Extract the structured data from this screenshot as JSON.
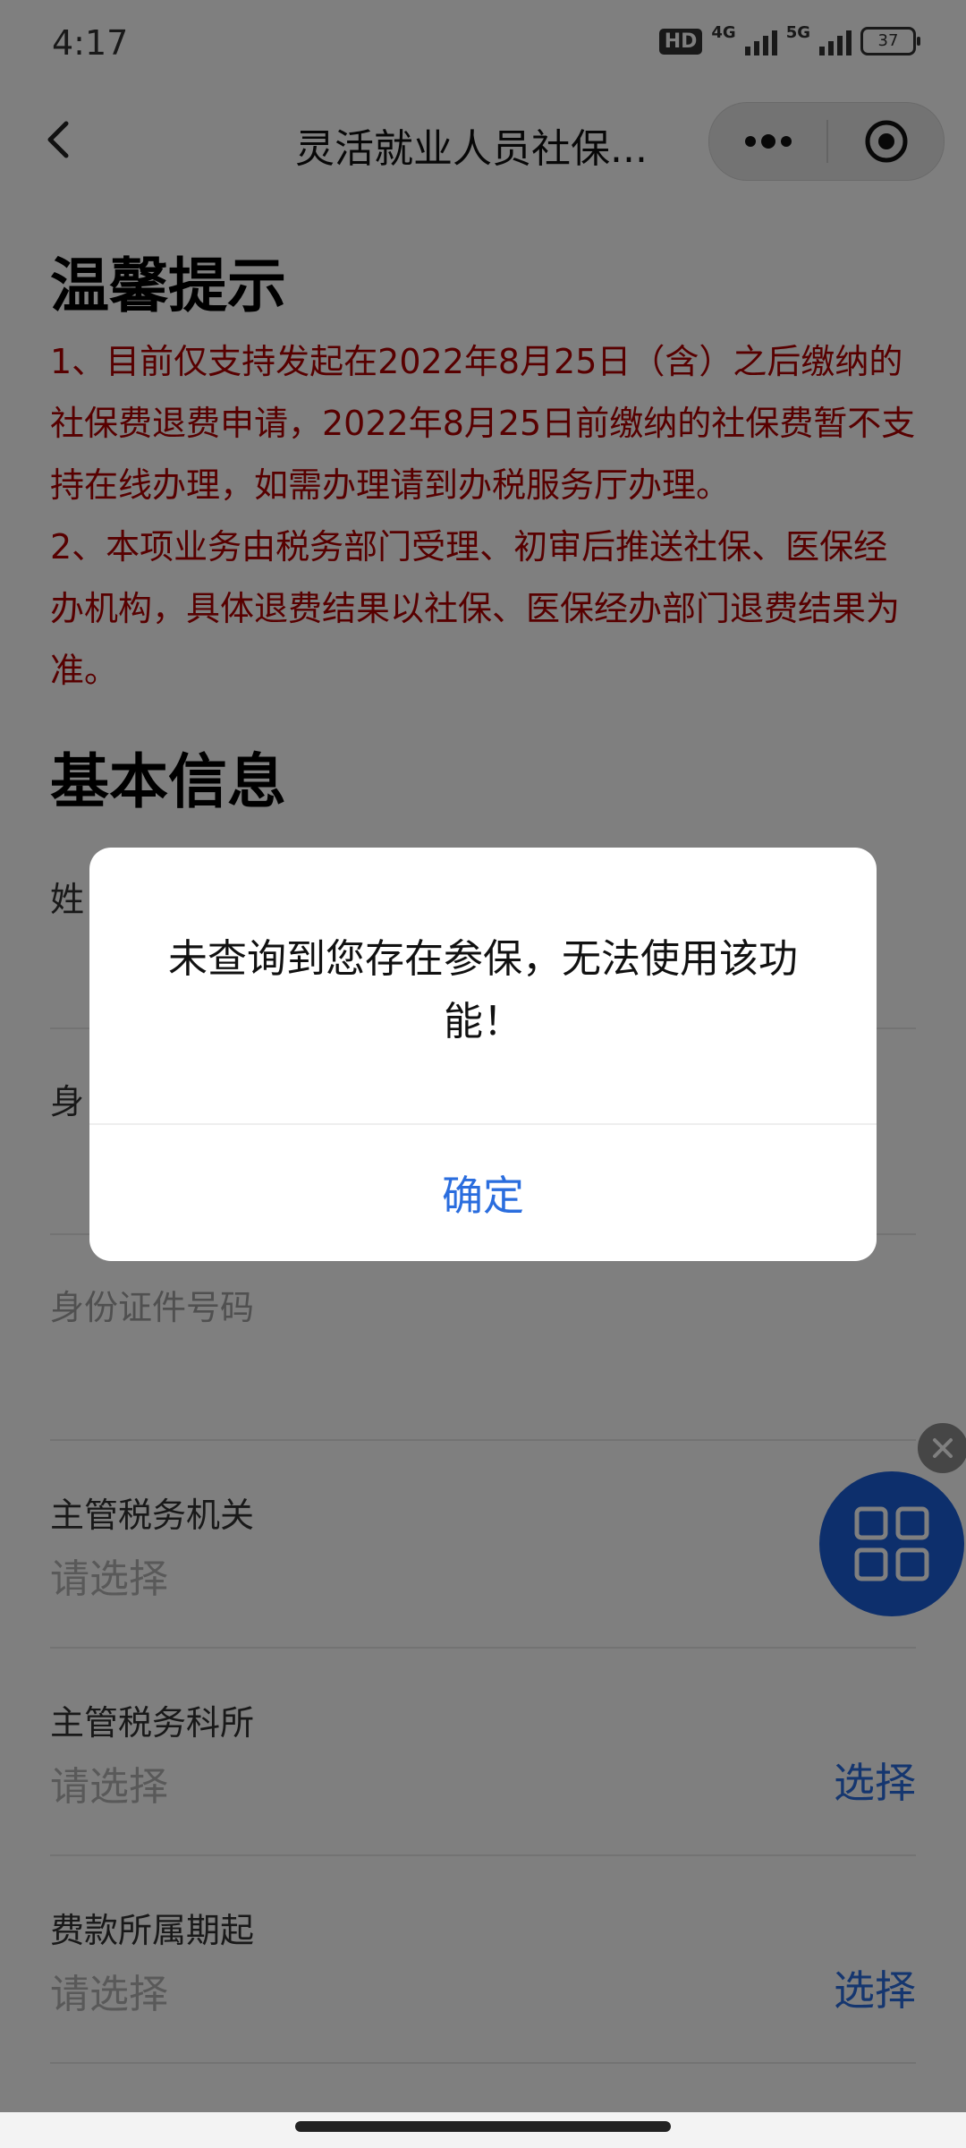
{
  "status_bar": {
    "time": "4:17",
    "hd_label": "HD",
    "network_1": "4G",
    "network_2": "5G",
    "battery": "37"
  },
  "navbar": {
    "title": "灵活就业人员社保...",
    "icons": [
      "back-icon",
      "more-icon",
      "close-target-icon"
    ]
  },
  "notice": {
    "heading": "温馨提示",
    "line1": "1、目前仅支持发起在2022年8月25日（含）之后缴纳的社保费退费申请，2022年8月25日前缴纳的社保费暂不支持在线办理，如需办理请到办税服务厅办理。",
    "line2": "2、本项业务由税务部门受理、初审后推送社保、医保经办机构，具体退费结果以社保、医保经办部门退费结果为准。",
    "color": "#b00000"
  },
  "basic_info": {
    "heading": "基本信息",
    "name_label_partial": "姓",
    "id_type_label_partial": "身",
    "id_number_label": "身份证件号码",
    "tax_authority": {
      "label": "主管税务机关",
      "placeholder": "请选择"
    },
    "tax_office": {
      "label": "主管税务科所",
      "placeholder": "请选择",
      "action": "选择"
    },
    "period_start": {
      "label": "费款所属期起",
      "placeholder": "请选择",
      "action": "选择"
    }
  },
  "dialog": {
    "message": "未查询到您存在参保，无法使用该功能！",
    "confirm": "确定"
  },
  "colors": {
    "accent": "#2a6dde",
    "float_button": "#1a5ed8"
  }
}
